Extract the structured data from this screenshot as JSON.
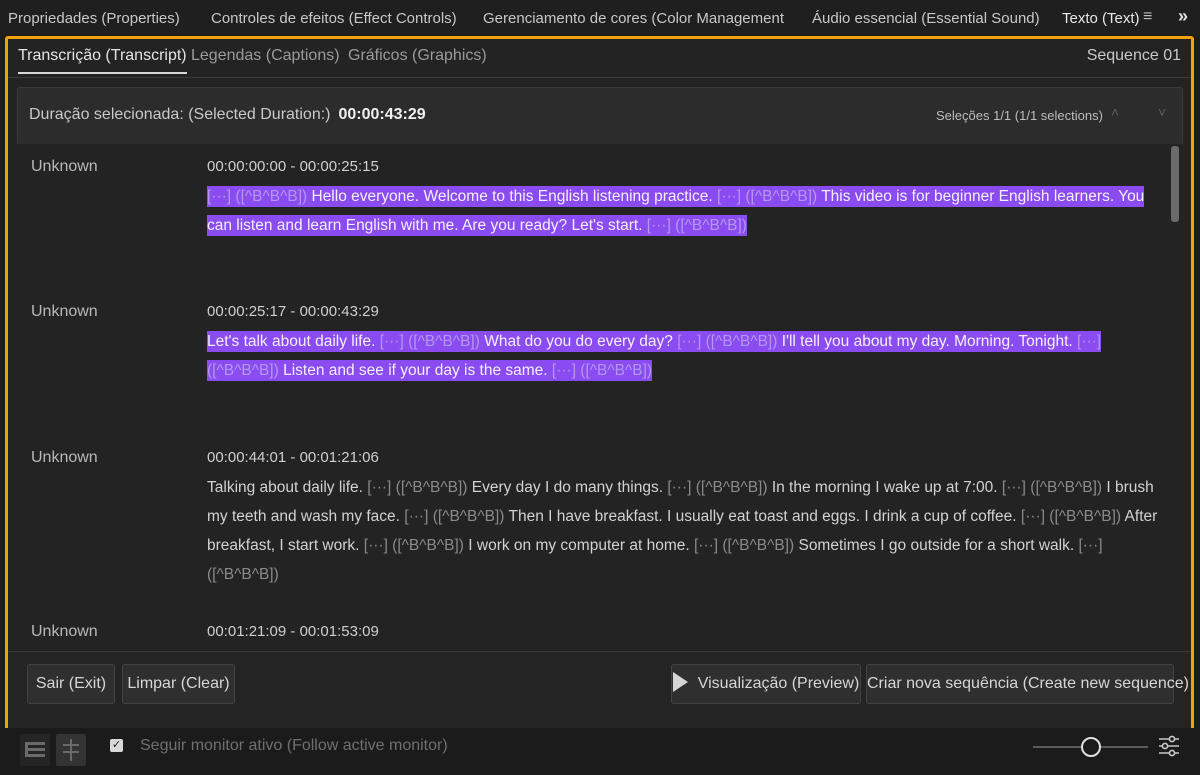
{
  "top_tabs": [
    {
      "label": "Propriedades (Properties)"
    },
    {
      "label": "Controles de efeitos (Effect Controls)"
    },
    {
      "label": "Gerenciamento de cores (Color Management"
    },
    {
      "label": "Áudio essencial (Essential Sound)"
    },
    {
      "label": "Texto (Text)"
    }
  ],
  "top_icons": {
    "menu": "≡",
    "more": "»"
  },
  "sub_tabs": [
    {
      "label": "Transcrição (Transcript)"
    },
    {
      "label": "Legendas (Captions)"
    },
    {
      "label": "Gráficos (Graphics)"
    }
  ],
  "sequence_name": "Sequence 01",
  "selection": {
    "label": "Duração selecionada: (Selected Duration:)",
    "duration": "00:00:43:29",
    "count": "Seleções 1/1 (1/1 selections)"
  },
  "transcript": [
    {
      "speaker": "Unknown",
      "time": "00:00:00:00 - 00:00:25:15",
      "highlighted": true,
      "segments": [
        {
          "t": "[···] ([^B^B^B])",
          "pause": true
        },
        {
          "t": " Hello everyone. Welcome to this English listening practice. "
        },
        {
          "t": "[···] ([^B^B^B])",
          "pause": true
        },
        {
          "t": " This video is for beginner English learners. You can listen and learn English with me. Are you ready? Let's start. "
        },
        {
          "t": "[···] ([^B^B^B])",
          "pause": true
        }
      ]
    },
    {
      "speaker": "Unknown",
      "time": "00:00:25:17 - 00:00:43:29",
      "highlighted": true,
      "segments": [
        {
          "t": "Let's talk about daily life. "
        },
        {
          "t": "[···] ([^B^B^B])",
          "pause": true
        },
        {
          "t": " What do you do every day? "
        },
        {
          "t": "[···] ([^B^B^B])",
          "pause": true
        },
        {
          "t": " I'll tell you about my day. Morning. Tonight. "
        },
        {
          "t": "[···] ([^B^B^B])",
          "pause": true
        },
        {
          "t": " Listen and see if your day is the same. "
        },
        {
          "t": "[···] ([^B^B^B])",
          "pause": true
        }
      ]
    },
    {
      "speaker": "Unknown",
      "time": "00:00:44:01 - 00:01:21:06",
      "highlighted": false,
      "segments": [
        {
          "t": "Talking about daily life. "
        },
        {
          "t": "[···] ([^B^B^B])",
          "pause": true
        },
        {
          "t": " Every day I do many things. "
        },
        {
          "t": "[···] ([^B^B^B])",
          "pause": true
        },
        {
          "t": " In the morning I wake up at 7:00. "
        },
        {
          "t": "[···] ([^B^B^B])",
          "pause": true
        },
        {
          "t": " I brush my teeth and wash my face. "
        },
        {
          "t": "[···] ([^B^B^B])",
          "pause": true
        },
        {
          "t": " Then I have breakfast. I usually eat toast and eggs. I drink a cup of coffee. "
        },
        {
          "t": "[···] ([^B^B^B])",
          "pause": true
        },
        {
          "t": " After breakfast, I start work. "
        },
        {
          "t": "[···] ([^B^B^B])",
          "pause": true
        },
        {
          "t": " I work on my computer at home. "
        },
        {
          "t": "[···] ([^B^B^B])",
          "pause": true
        },
        {
          "t": " Sometimes I go outside for a short walk. "
        },
        {
          "t": "[···] ([^B^B^B])",
          "pause": true
        }
      ]
    },
    {
      "speaker": "Unknown",
      "time": "00:01:21:09 - 00:01:53:09",
      "highlighted": false,
      "segments": []
    }
  ],
  "buttons": {
    "exit": "Sair (Exit)",
    "clear": "Limpar (Clear)",
    "preview": "Visualização (Preview)",
    "create": "Criar nova sequência (Create new sequence)"
  },
  "bottom": {
    "follow_label": "Seguir monitor ativo (Follow active monitor)",
    "follow_checked": true
  },
  "colors": {
    "accent_frame": "#f0a30a",
    "highlight": "#8a4bf0"
  }
}
